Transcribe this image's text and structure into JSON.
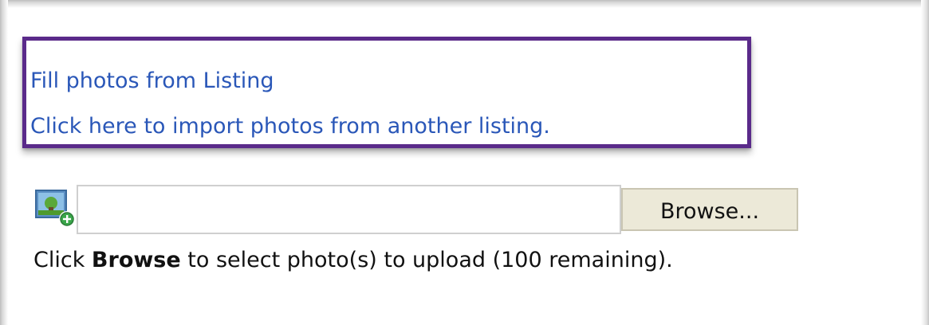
{
  "import_links": {
    "fill_from_listing": "Fill photos from Listing",
    "import_from_other": "Click here to import photos from another listing."
  },
  "upload": {
    "file_value": "",
    "browse_label": "Browse...",
    "instruction_prefix": "Click ",
    "instruction_bold": "Browse",
    "instruction_suffix": " to select photo(s) to upload (100 remaining)."
  },
  "icons": {
    "add_photo": "add-photo-icon"
  },
  "colors": {
    "highlight_border": "#5a2a8a",
    "link": "#2a57b8",
    "button_bg": "#ece9d8"
  }
}
